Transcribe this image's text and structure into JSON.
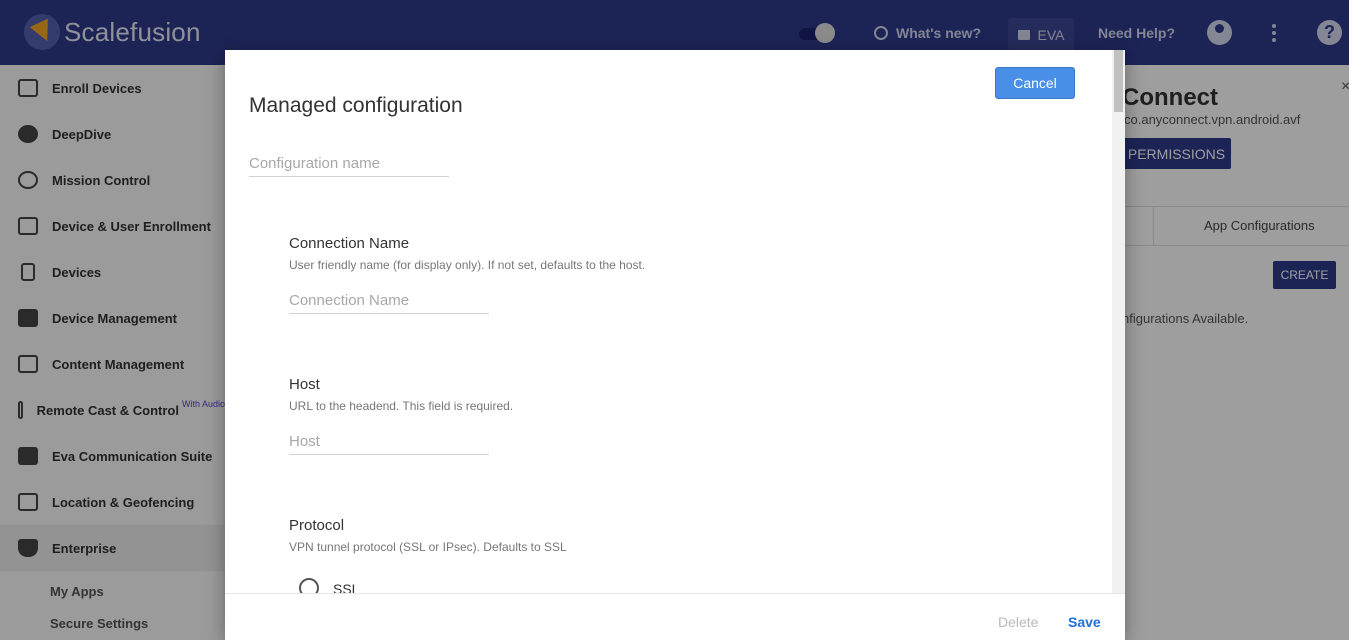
{
  "topbar": {
    "brand": "Scalefusion",
    "whats_new": "What's new?",
    "eva": "EVA",
    "need_help": "Need Help?",
    "help_symbol": "?"
  },
  "sidebar": {
    "items": [
      {
        "label": "Enroll Devices",
        "icon": "enroll-devices-icon"
      },
      {
        "label": "DeepDive",
        "icon": "deepdive-icon"
      },
      {
        "label": "Mission Control",
        "icon": "mission-control-icon"
      },
      {
        "label": "Device & User Enrollment",
        "icon": "device-user-enrollment-icon"
      },
      {
        "label": "Devices",
        "icon": "phone-icon"
      },
      {
        "label": "Device Management",
        "icon": "device-management-icon"
      },
      {
        "label": "Content Management",
        "icon": "folder-icon"
      },
      {
        "label": "Remote Cast & Control",
        "icon": "cast-icon",
        "badge": "With Audio"
      },
      {
        "label": "Eva Communication Suite",
        "icon": "chat-icon"
      },
      {
        "label": "Location & Geofencing",
        "icon": "map-icon"
      },
      {
        "label": "Enterprise",
        "icon": "shield-icon"
      }
    ],
    "sub_items": [
      "My Apps",
      "Secure Settings"
    ]
  },
  "background_panel": {
    "title": "Connect",
    "package": "co.anyconnect.vpn.android.avf",
    "permissions": "PERMISSIONS",
    "tab": "App Configurations",
    "create": "CREATE",
    "empty": "nfigurations Available.",
    "close": "×"
  },
  "modal": {
    "title": "Managed configuration",
    "cancel": "Cancel",
    "config_name_placeholder": "Configuration name",
    "fields": [
      {
        "label": "Connection Name",
        "help": "User friendly name (for display only). If not set, defaults to the host.",
        "placeholder": "Connection Name"
      },
      {
        "label": "Host",
        "help": "URL to the headend. This field is required.",
        "placeholder": "Host"
      },
      {
        "label": "Protocol",
        "help": "VPN tunnel protocol (SSL or IPsec). Defaults to SSL",
        "options": [
          "SSL"
        ]
      }
    ],
    "delete": "Delete",
    "save": "Save"
  },
  "colors": {
    "topbar": "#2e3a8c",
    "primary_button": "#4a8fe7",
    "save_link": "#1e6fd9"
  }
}
